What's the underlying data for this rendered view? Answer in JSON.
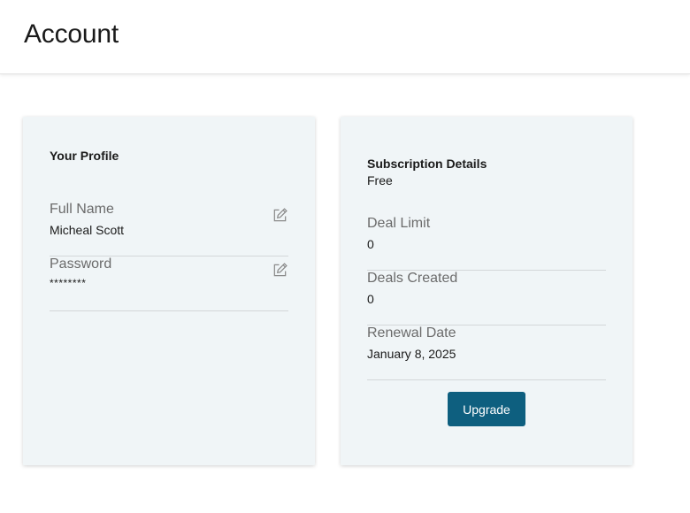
{
  "header": {
    "title": "Account"
  },
  "profile": {
    "title": "Your Profile",
    "fields": [
      {
        "label": "Full Name",
        "value": "Micheal Scott",
        "edit_icon": "edit-icon"
      },
      {
        "label": "Password",
        "value": "********",
        "edit_icon": "edit-icon"
      }
    ]
  },
  "subscription": {
    "title": "Subscription Details",
    "plan": "Free",
    "fields": [
      {
        "label": "Deal Limit",
        "value": "0"
      },
      {
        "label": "Deals Created",
        "value": "0"
      },
      {
        "label": "Renewal Date",
        "value": "January 8, 2025"
      }
    ],
    "upgrade_label": "Upgrade"
  },
  "colors": {
    "card_background": "#f0f5f7",
    "button": "#0e5f7f",
    "label": "#6b6b6b"
  }
}
